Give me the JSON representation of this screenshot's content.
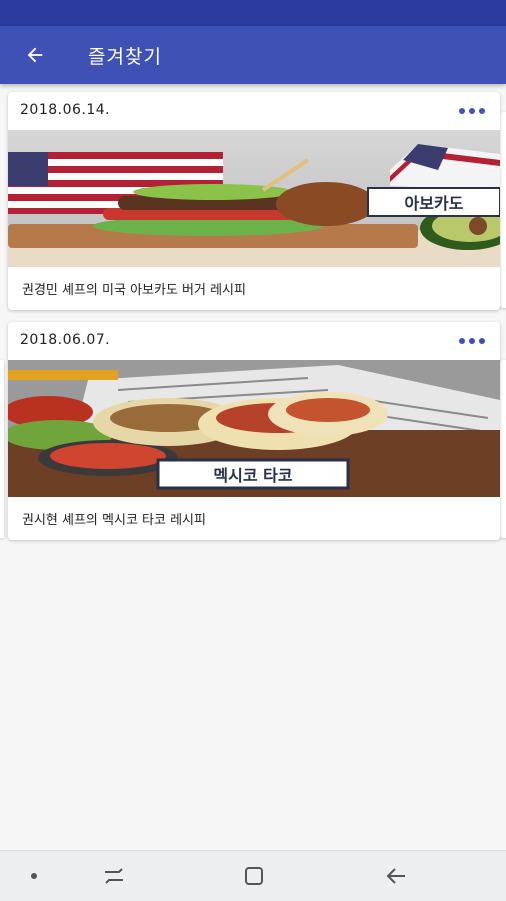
{
  "header": {
    "title": "즐겨찾기"
  },
  "favorites": [
    {
      "date": "2018.06.14.",
      "title": "권경민 셰프의 미국 아보카도 버거 레시피",
      "thumb_caption": "아보카도"
    },
    {
      "date": "2018.06.07.",
      "title": "권시현 셰프의 멕시코 타코 레시피",
      "thumb_caption": "멕시코 타코"
    }
  ],
  "icons": {
    "back": "arrow-back-icon",
    "more": "more-horizontal-icon",
    "nav_dot": "dot-icon",
    "nav_recents": "recent-apps-icon",
    "nav_home": "home-icon",
    "nav_back": "back-icon"
  },
  "colors": {
    "status_bar": "#2b3a9d",
    "app_bar": "#3f51b5",
    "accent": "#3f51b5",
    "background": "#f6f6f6"
  }
}
